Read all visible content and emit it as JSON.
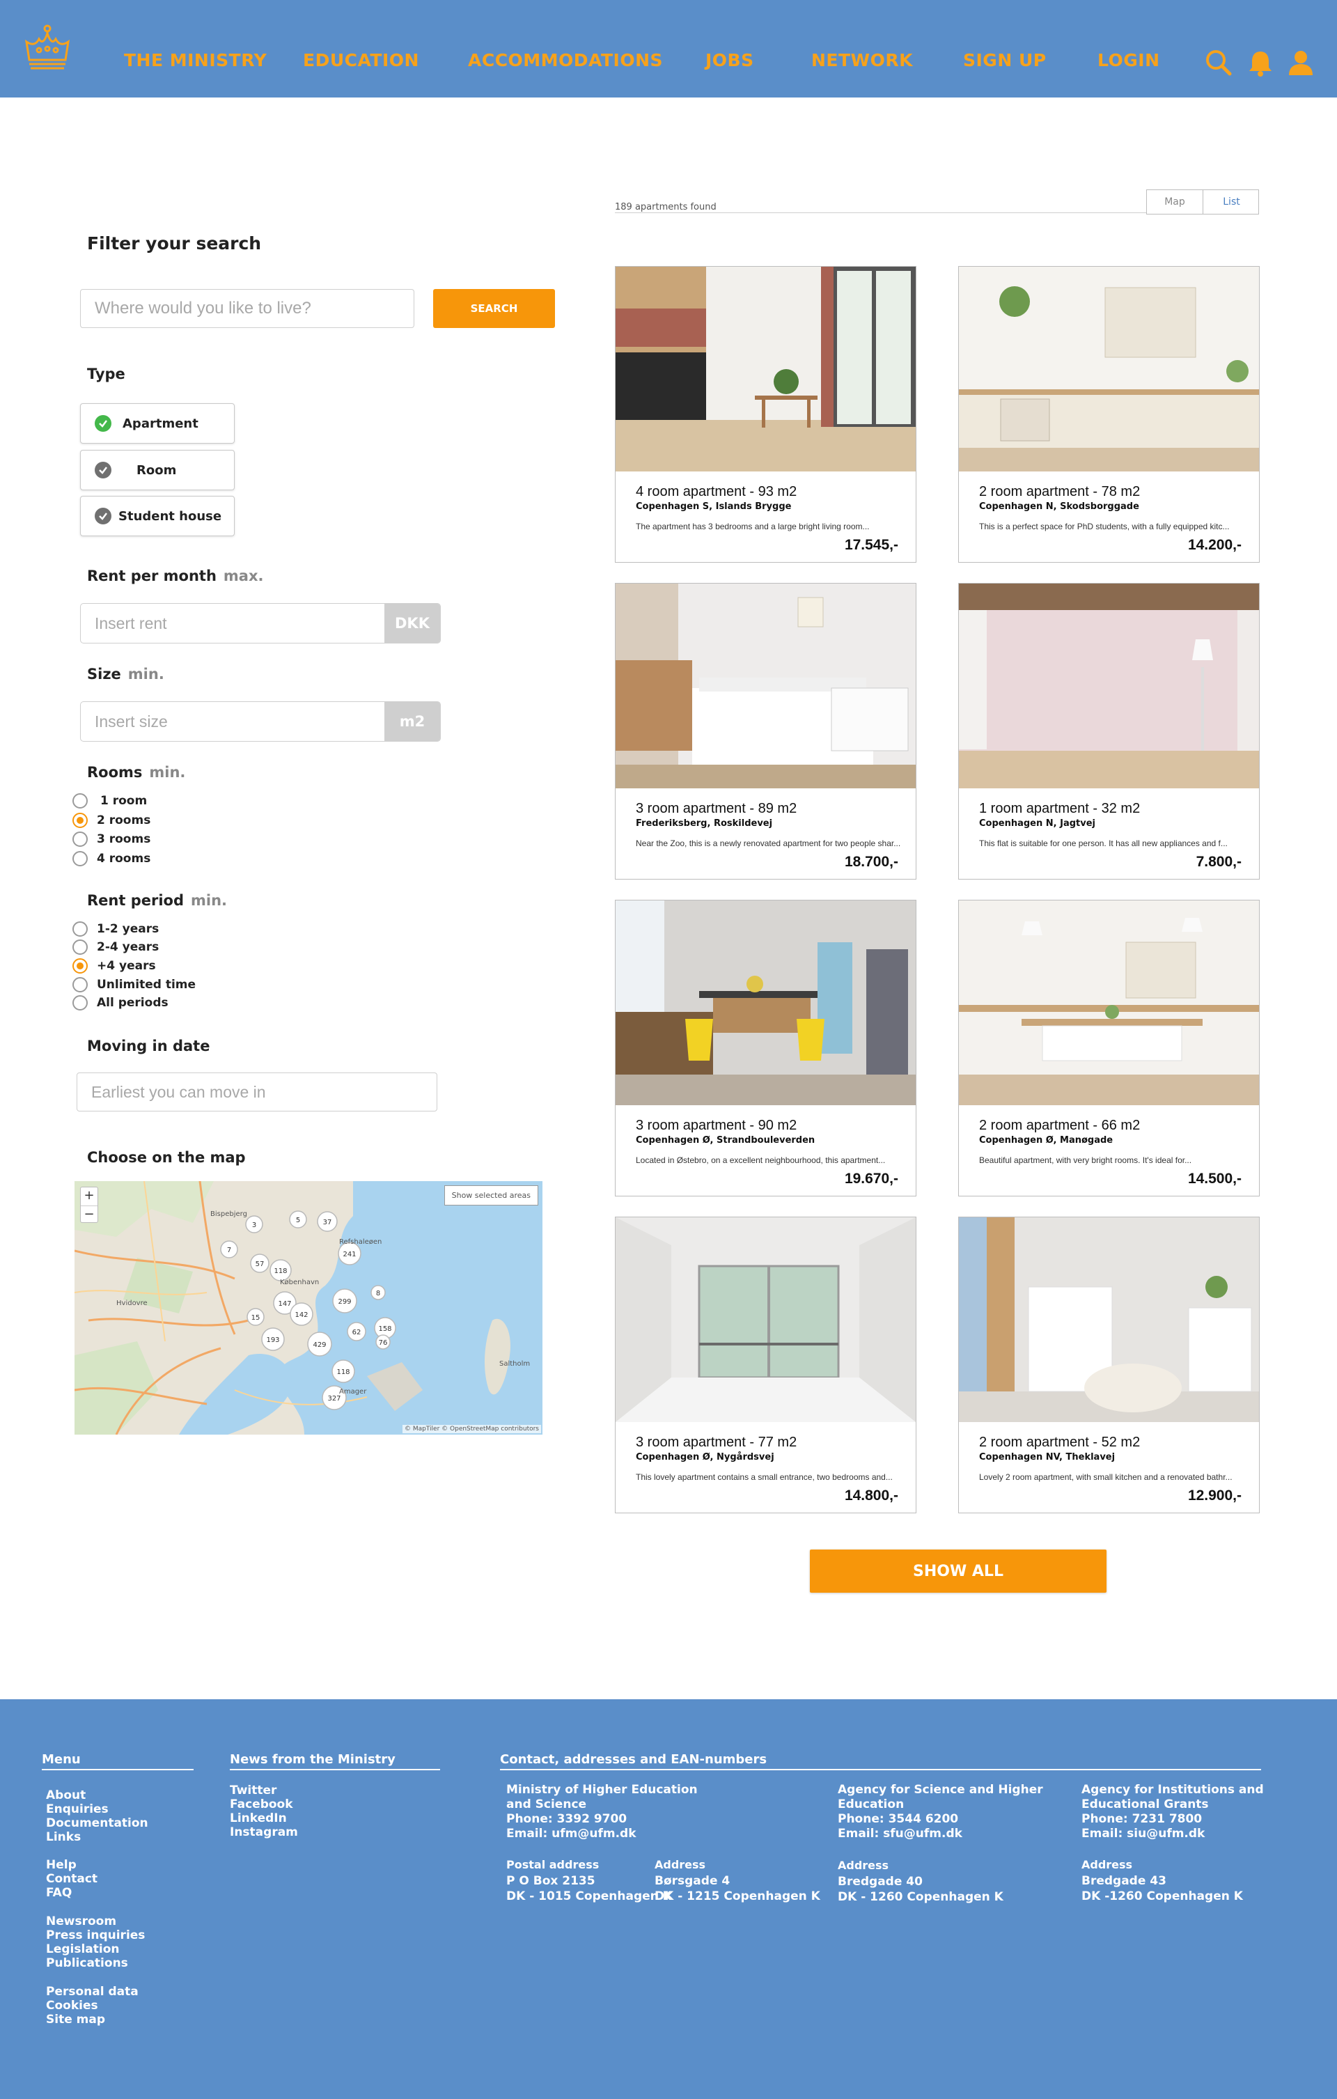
{
  "nav": {
    "items": [
      "THE MINISTRY",
      "EDUCATION",
      "ACCOMMODATIONS",
      "JOBS",
      "NETWORK",
      "SIGN UP",
      "LOGIN"
    ],
    "icons": [
      "search-icon",
      "bell-icon",
      "user-icon"
    ]
  },
  "filter": {
    "heading": "Filter your search",
    "search_placeholder": "Where would you like to live?",
    "search_button": "SEARCH",
    "type_label": "Type",
    "types": [
      {
        "label": "Apartment",
        "selected": true
      },
      {
        "label": "Room",
        "selected": false
      },
      {
        "label": "Student house",
        "selected": false
      }
    ],
    "rent_label": "Rent per month",
    "rent_qualifier": "max.",
    "rent_placeholder": "Insert rent",
    "rent_unit": "DKK",
    "size_label": "Size",
    "size_qualifier": "min.",
    "size_placeholder": "Insert size",
    "size_unit": "m2",
    "rooms_label": "Rooms",
    "rooms_qualifier": "min.",
    "rooms": [
      "1 room",
      "2 rooms",
      "3 rooms",
      "4 rooms"
    ],
    "rooms_selected": "2 rooms",
    "period_label": "Rent period",
    "period_qualifier": "min.",
    "periods": [
      "1-2 years",
      "2-4 years",
      "+4 years",
      "Unlimited time",
      "All periods"
    ],
    "period_selected": "+4 years",
    "moving_label": "Moving in date",
    "moving_placeholder": "Earliest you can move in",
    "map_label": "Choose on the map"
  },
  "map": {
    "zoom_in": "+",
    "zoom_out": "−",
    "show_selected": "Show selected areas",
    "attribution": "© MapTiler © OpenStreetMap contributors",
    "places": [
      "Bispebjerg",
      "Hvidovre",
      "København",
      "Refshaleøen",
      "Amager",
      "Saltholm"
    ],
    "clusters": [
      "3",
      "5",
      "37",
      "7",
      "57",
      "118",
      "241",
      "147",
      "299",
      "15",
      "142",
      "62",
      "158",
      "76",
      "193",
      "429",
      "118",
      "327",
      "8"
    ]
  },
  "listing": {
    "count_text": "189 apartments found",
    "view_map": "Map",
    "view_list": "List",
    "show_all": "SHOW ALL",
    "cards": [
      {
        "title": "4 room apartment - 93 m2",
        "address": "Copenhagen S, Islands Brygge",
        "desc": "The apartment has 3 bedrooms and a large bright living room...",
        "price": "17.545,-"
      },
      {
        "title": "2 room apartment - 78 m2",
        "address": "Copenhagen N, Skodsborggade",
        "desc": "This is a perfect space for PhD students, with a fully equipped kitc...",
        "price": "14.200,-"
      },
      {
        "title": "3 room apartment - 89 m2",
        "address": "Frederiksberg, Roskildevej",
        "desc": "Near the Zoo, this is a newly renovated apartment for two people shar...",
        "price": "18.700,-"
      },
      {
        "title": "1 room apartment - 32 m2",
        "address": "Copenhagen N, Jagtvej",
        "desc": "This flat is suitable for one person. It has all new appliances and f...",
        "price": "7.800,-"
      },
      {
        "title": "3 room apartment - 90 m2",
        "address": "Copenhagen Ø, Strandbouleverden",
        "desc": "Located in Østebro, on a excellent neighbourhood, this apartment...",
        "price": "19.670,-"
      },
      {
        "title": "2 room apartment - 66 m2",
        "address": "Copenhagen Ø, Manøgade",
        "desc": "Beautiful apartment, with very bright rooms. It's ideal for...",
        "price": "14.500,-"
      },
      {
        "title": "3 room apartment - 77 m2",
        "address": "Copenhagen Ø, Nygårdsvej",
        "desc": "This lovely apartment contains a small entrance, two bedrooms and...",
        "price": "14.800,-"
      },
      {
        "title": "2 room apartment - 52 m2",
        "address": "Copenhagen NV, Theklavej",
        "desc": "Lovely 2 room apartment, with small kitchen and a renovated bathr...",
        "price": "12.900,-"
      }
    ]
  },
  "footer": {
    "menu_heading": "Menu",
    "menu_groups": [
      [
        "About",
        "Enquiries",
        "Documentation",
        "Links"
      ],
      [
        "Help",
        "Contact",
        "FAQ"
      ],
      [
        "Newsroom",
        "Press inquiries",
        "Legislation",
        "Publications"
      ],
      [
        "Personal data",
        "Cookies",
        "Site map"
      ]
    ],
    "news_heading": "News from the Ministry",
    "news_links": [
      "Twitter",
      "Facebook",
      "LinkedIn",
      "Instagram"
    ],
    "contact_heading": "Contact, addresses and EAN-numbers",
    "orgs": [
      {
        "name1": "Ministry of Higher Education",
        "name2": "and Science",
        "phone": "Phone: 3392 9700",
        "email": "Email: ufm@ufm.dk"
      },
      {
        "name1": "Agency for Science and Higher",
        "name2": "Education",
        "phone": "Phone: 3544 6200",
        "email": "Email: sfu@ufm.dk"
      },
      {
        "name1": "Agency for Institutions and",
        "name2": "Educational Grants",
        "phone": "Phone: 7231 7800",
        "email": "Email: siu@ufm.dk"
      }
    ],
    "addresses": [
      [
        "Postal address",
        "P O Box 2135",
        "DK - 1015 Copenhagen K"
      ],
      [
        "Address",
        "Børsgade 4",
        "DK - 1215 Copenhagen K"
      ],
      [
        "Address",
        "Bredgade 40",
        "DK - 1260 Copenhagen K"
      ],
      [
        "Address",
        "Bredgade 43",
        "DK -1260 Copenhagen K"
      ]
    ]
  },
  "colors": {
    "header_bg": "#5a8ec9",
    "accent": "#f7960a",
    "nav_text": "#f7a21b",
    "check_on": "#43b84a"
  }
}
